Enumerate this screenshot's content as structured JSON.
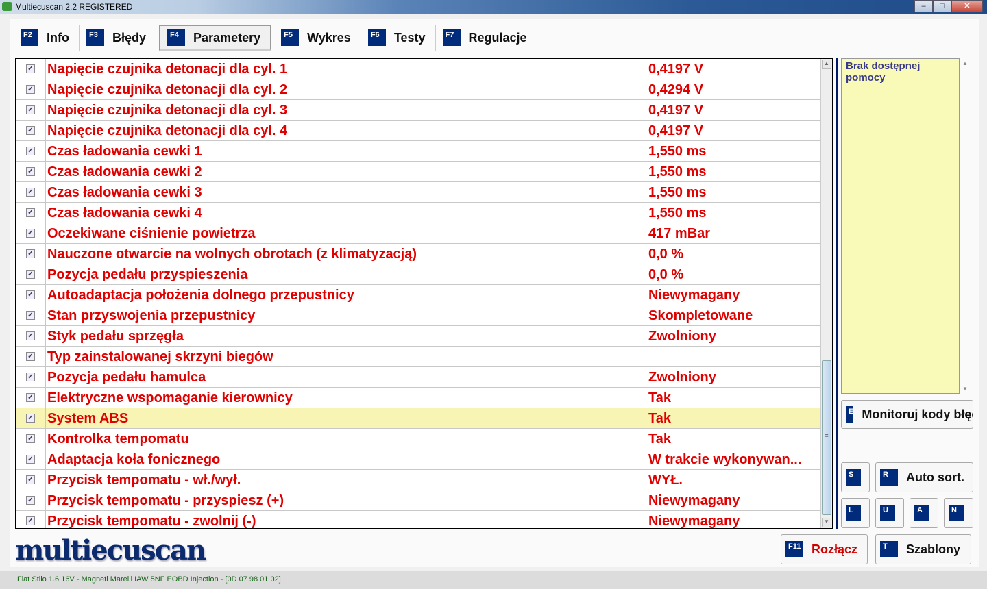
{
  "window": {
    "title": "Multiecuscan 2.2 REGISTERED",
    "min": "–",
    "max": "□",
    "close": "✕"
  },
  "tabs": [
    {
      "key": "F2",
      "label": "Info"
    },
    {
      "key": "F3",
      "label": "Błędy"
    },
    {
      "key": "F4",
      "label": "Parametery"
    },
    {
      "key": "F5",
      "label": "Wykres"
    },
    {
      "key": "F6",
      "label": "Testy"
    },
    {
      "key": "F7",
      "label": "Regulacje"
    }
  ],
  "rows": [
    {
      "name": "Napięcie czujnika detonacji dla cyl. 1",
      "value": "0,4197 V"
    },
    {
      "name": "Napięcie czujnika detonacji dla cyl. 2",
      "value": "0,4294 V"
    },
    {
      "name": "Napięcie czujnika detonacji dla cyl. 3",
      "value": "0,4197 V"
    },
    {
      "name": "Napięcie czujnika detonacji dla cyl. 4",
      "value": "0,4197 V"
    },
    {
      "name": "Czas ładowania cewki 1",
      "value": "1,550 ms"
    },
    {
      "name": "Czas ładowania cewki 2",
      "value": "1,550 ms"
    },
    {
      "name": "Czas ładowania cewki 3",
      "value": "1,550 ms"
    },
    {
      "name": "Czas ładowania cewki 4",
      "value": "1,550 ms"
    },
    {
      "name": "Oczekiwane ciśnienie powietrza",
      "value": "417 mBar"
    },
    {
      "name": "Nauczone otwarcie na wolnych obrotach (z klimatyzacją)",
      "value": "0,0 %"
    },
    {
      "name": "Pozycja pedału przyspieszenia",
      "value": "0,0 %"
    },
    {
      "name": "Autoadaptacja położenia dolnego przepustnicy",
      "value": "Niewymagany"
    },
    {
      "name": "Stan przyswojenia przepustnicy",
      "value": "Skompletowane"
    },
    {
      "name": "Styk pedału sprzęgła",
      "value": "Zwolniony"
    },
    {
      "name": "Typ zainstalowanej skrzyni biegów",
      "value": ""
    },
    {
      "name": "Pozycja pedału hamulca",
      "value": "Zwolniony"
    },
    {
      "name": "Elektryczne wspomaganie kierownicy",
      "value": "Tak"
    },
    {
      "name": "System ABS",
      "value": "Tak",
      "selected": true
    },
    {
      "name": "Kontrolka tempomatu",
      "value": "Tak"
    },
    {
      "name": "Adaptacja koła fonicznego",
      "value": "W trakcie wykonywan..."
    },
    {
      "name": "Przycisk tempomatu - wł./wył.",
      "value": "WYŁ."
    },
    {
      "name": "Przycisk tempomatu - przyspiesz (+)",
      "value": "Niewymagany"
    },
    {
      "name": "Przycisk tempomatu - zwolnij (-)",
      "value": "Niewymagany"
    }
  ],
  "help": {
    "text": "Brak dostępnej pomocy"
  },
  "buttons": {
    "monitor": {
      "key": "E",
      "label": "Monitoruj kody błędów"
    },
    "s": {
      "key": "S"
    },
    "autosort": {
      "key": "R",
      "label": "Auto sort."
    },
    "l": {
      "key": "L"
    },
    "u": {
      "key": "U"
    },
    "a": {
      "key": "A"
    },
    "n": {
      "key": "N"
    },
    "disconnect": {
      "key": "F11",
      "label": "Rozłącz"
    },
    "templates": {
      "key": "T",
      "label": "Szablony"
    }
  },
  "logo": "multiecuscan",
  "status": "Fiat Stilo 1.6 16V - Magneti Marelli IAW 5NF EOBD Injection - [0D 07 98 01 02]"
}
